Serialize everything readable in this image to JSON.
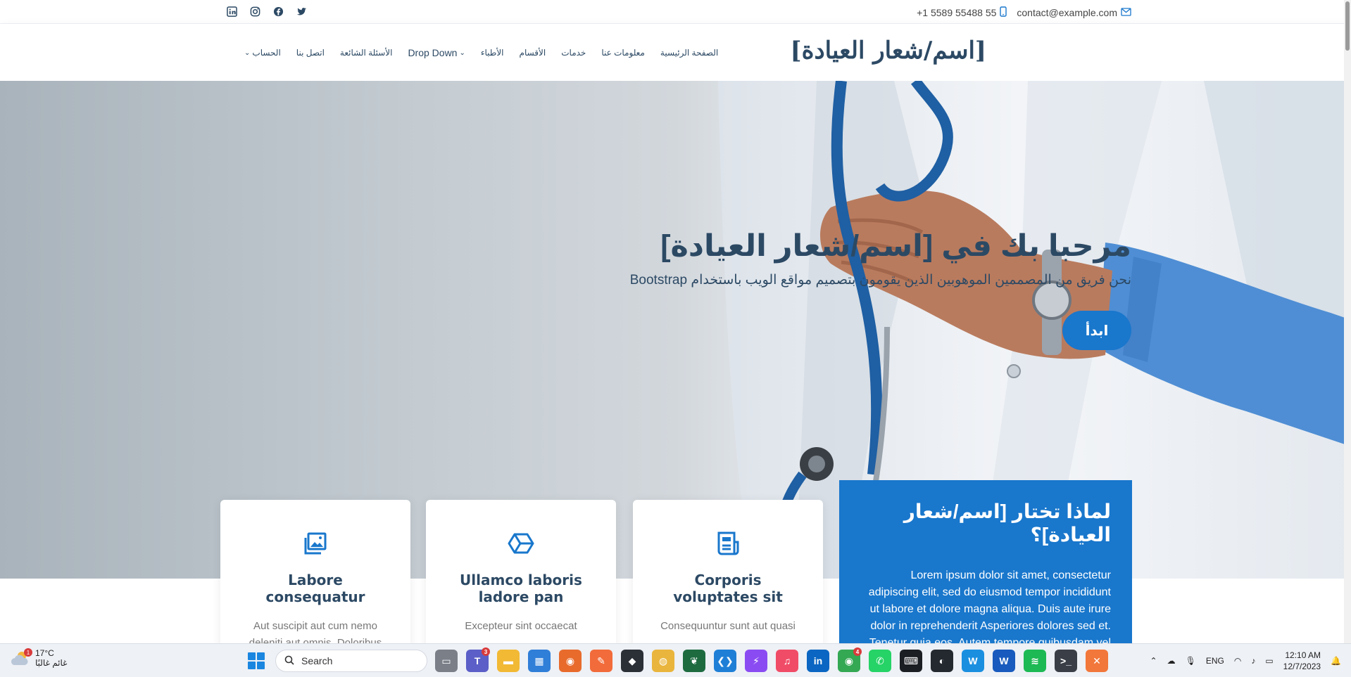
{
  "topbar": {
    "email": "contact@example.com",
    "phone": "+1 5589 55488 55",
    "social": [
      "linkedin-icon",
      "instagram-icon",
      "facebook-icon",
      "twitter-icon"
    ]
  },
  "header": {
    "logo": "[اسم/شعار العيادة]",
    "nav": [
      {
        "label": "الصفحة الرئيسية"
      },
      {
        "label": "معلومات عنا"
      },
      {
        "label": "خدمات"
      },
      {
        "label": "الأقسام"
      },
      {
        "label": "الأطباء"
      },
      {
        "label": "Drop Down",
        "dropdown": true
      },
      {
        "label": "الأسئلة الشائعة"
      },
      {
        "label": "اتصل بنا"
      },
      {
        "label": "الحساب",
        "dropdown": true
      }
    ]
  },
  "hero": {
    "title": "مرحبا بك في [اسم/شعار العيادة]",
    "subtitle": "نحن فريق من المصممين الموهوبين الذين يقومون بتصميم مواقع الويب باستخدام Bootstrap",
    "button": "ابدأ"
  },
  "why": {
    "title": "لماذا تختار [اسم/شعار العيادة]؟",
    "text": "Lorem ipsum dolor sit amet, consectetur adipiscing elit, sed do eiusmod tempor incididunt ut labore et dolore magna aliqua. Duis aute irure dolor in reprehenderit Asperiores dolores sed et. Tenetur quia eos. Autem tempore quibusdam vel necessitatibus"
  },
  "cards": [
    {
      "icon": "images-icon",
      "title": "Labore consequatur",
      "text": "Aut suscipit aut cum nemo deleniti aut omnis. Doloribus"
    },
    {
      "icon": "cube-icon",
      "title": "Ullamco laboris ladore pan",
      "text": "Excepteur sint occaecat"
    },
    {
      "icon": "receipt-icon",
      "title": "Corporis voluptates sit",
      "text": "Consequuntur sunt aut quasi"
    }
  ],
  "taskbar": {
    "weather_temp": "17°C",
    "weather_desc": "غائم غالبًا",
    "weather_badge": "1",
    "search": "Search",
    "lang": "ENG",
    "time": "12:10 AM",
    "date": "12/7/2023",
    "apps": [
      {
        "name": "task-view-icon",
        "color": "#7a7f88",
        "glyph": "▭"
      },
      {
        "name": "teams-icon",
        "color": "#5b5fc7",
        "glyph": "T",
        "badge": "3"
      },
      {
        "name": "file-explorer-icon",
        "color": "#f2b935",
        "glyph": "▬"
      },
      {
        "name": "store-icon",
        "color": "#2f7ed8",
        "glyph": "▦"
      },
      {
        "name": "firefox-icon",
        "color": "#e86b2c",
        "glyph": "◉"
      },
      {
        "name": "postman-icon",
        "color": "#f26b3a",
        "glyph": "✎"
      },
      {
        "name": "git-icon",
        "color": "#2b2f36",
        "glyph": "◆"
      },
      {
        "name": "chrome-canary-icon",
        "color": "#e9b53c",
        "glyph": "◍"
      },
      {
        "name": "mongodb-icon",
        "color": "#1e6b40",
        "glyph": "❦"
      },
      {
        "name": "vscode-icon",
        "color": "#1f7fd6",
        "glyph": "❮❯"
      },
      {
        "name": "messenger-icon",
        "color": "#8a4cf2",
        "glyph": "⚡"
      },
      {
        "name": "itunes-icon",
        "color": "#f04c67",
        "glyph": "♫"
      },
      {
        "name": "linkedin-app-icon",
        "color": "#0a66c2",
        "glyph": "in"
      },
      {
        "name": "chrome-icon",
        "color": "#34a853",
        "glyph": "◉",
        "badge": "4"
      },
      {
        "name": "whatsapp-icon",
        "color": "#25d366",
        "glyph": "✆"
      },
      {
        "name": "terminal-icon",
        "color": "#1b1e23",
        "glyph": "⌨"
      },
      {
        "name": "github-icon",
        "color": "#24292f",
        "glyph": "◐"
      },
      {
        "name": "webstorm-icon",
        "color": "#1a8fe0",
        "glyph": "W"
      },
      {
        "name": "word-icon",
        "color": "#185abd",
        "glyph": "W"
      },
      {
        "name": "spotify-icon",
        "color": "#1db954",
        "glyph": "≋"
      },
      {
        "name": "console-icon",
        "color": "#3a3f47",
        "glyph": ">_"
      },
      {
        "name": "xampp-icon",
        "color": "#f2773a",
        "glyph": "✕"
      }
    ]
  }
}
